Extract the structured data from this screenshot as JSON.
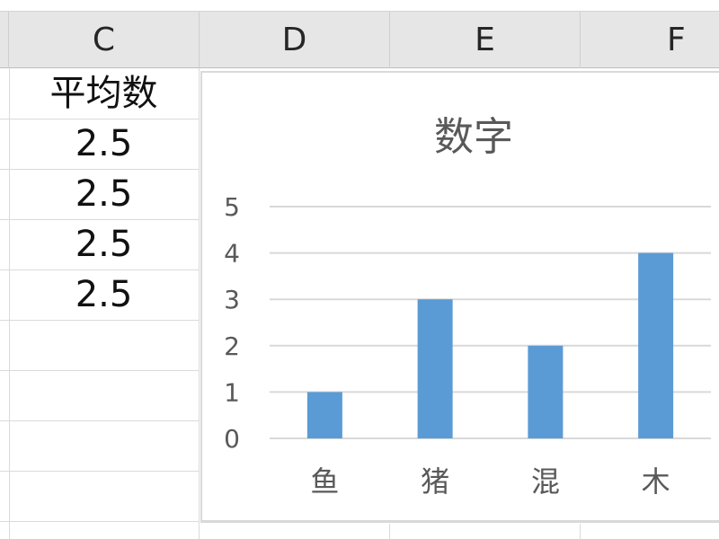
{
  "spreadsheet": {
    "columns": [
      "C",
      "D",
      "E",
      "F"
    ],
    "cells": [
      {
        "column": "C",
        "value": "平均数"
      },
      {
        "column": "C",
        "value": "2.5"
      },
      {
        "column": "C",
        "value": "2.5"
      },
      {
        "column": "C",
        "value": "2.5"
      },
      {
        "column": "C",
        "value": "2.5"
      }
    ]
  },
  "colors": {
    "bar": "#5b9bd5",
    "gridline": "#d9d9d9",
    "header_bg": "#e6e6e6",
    "axis_text": "#595959"
  },
  "chart_data": {
    "type": "bar",
    "title": "数字",
    "categories": [
      "鱼",
      "猪",
      "混",
      "木"
    ],
    "values": [
      1,
      3,
      2,
      4
    ],
    "xlabel": "",
    "ylabel": "",
    "ylim": [
      0,
      5
    ],
    "yticks": [
      "0",
      "1",
      "2",
      "3",
      "4",
      "5"
    ],
    "grid": true,
    "legend": "none"
  }
}
